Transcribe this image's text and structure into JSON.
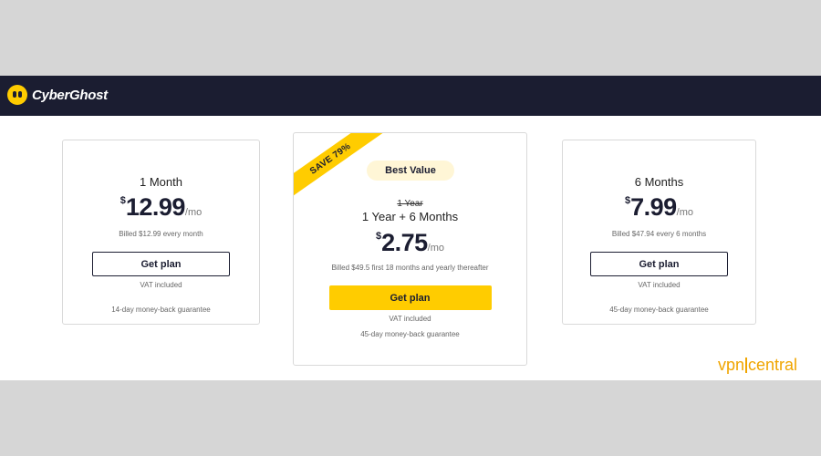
{
  "header": {
    "brand": "CyberGhost"
  },
  "plans": [
    {
      "name": "1 Month",
      "currency": "$",
      "price": "12.99",
      "period": "/mo",
      "billed": "Billed $12.99 every month",
      "button": "Get plan",
      "vat": "VAT included",
      "guarantee": "14-day money-back guarantee"
    },
    {
      "ribbon": "SAVE 79%",
      "badge": "Best Value",
      "old_term": "1 Year",
      "name": "1 Year + 6 Months",
      "currency": "$",
      "price": "2.75",
      "period": "/mo",
      "billed": "Billed $49.5 first 18 months and yearly thereafter",
      "button": "Get plan",
      "vat": "VAT included",
      "guarantee": "45-day money-back guarantee"
    },
    {
      "name": "6 Months",
      "currency": "$",
      "price": "7.99",
      "period": "/mo",
      "billed": "Billed $47.94 every 6 months",
      "button": "Get plan",
      "vat": "VAT included",
      "guarantee": "45-day money-back guarantee"
    }
  ],
  "watermark": {
    "left": "vpn",
    "right": "central"
  },
  "colors": {
    "header_bg": "#1b1d31",
    "accent": "#ffcc00",
    "watermark": "#f0a500"
  }
}
